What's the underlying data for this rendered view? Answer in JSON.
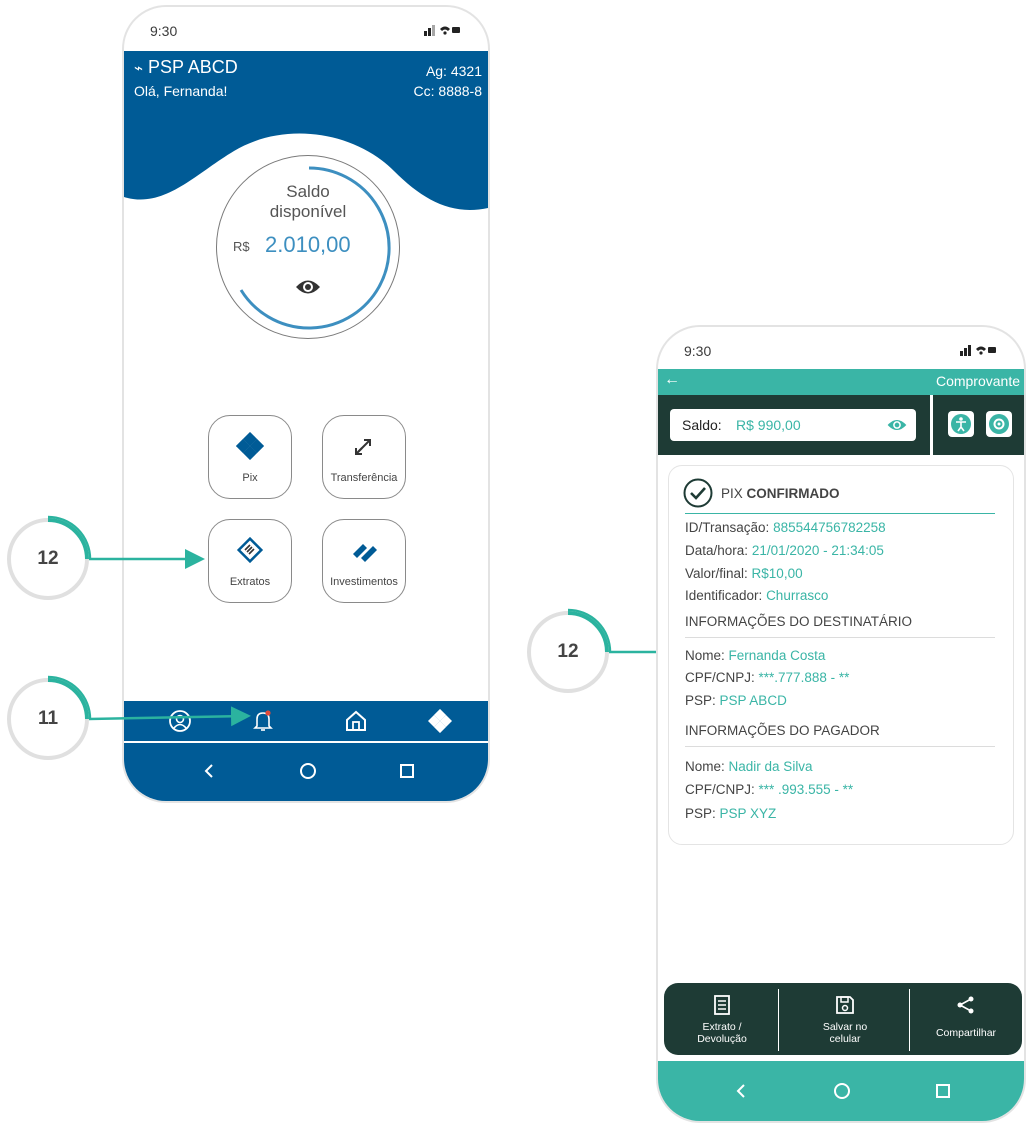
{
  "phone1": {
    "status": {
      "time": "9:30"
    },
    "header": {
      "brand": "PSP ABCD",
      "greeting": "Olá, Fernanda!",
      "agency": "Ag: 4321",
      "account": "Cc: 8888-8"
    },
    "balance": {
      "label_line1": "Saldo",
      "label_line2": "disponível",
      "currency": "R$",
      "value": "2.010,00",
      "icon": "eye-icon"
    },
    "tiles": [
      {
        "label": "Pix",
        "icon": "pix-icon"
      },
      {
        "label": "Transferência",
        "icon": "transfer-icon"
      },
      {
        "label": "Extratos",
        "icon": "statement-icon"
      },
      {
        "label": "Investimentos",
        "icon": "investments-icon"
      }
    ],
    "tabbar": [
      "profile-icon",
      "bell-icon",
      "home-icon",
      "pix-icon"
    ],
    "navbar": [
      "back-icon",
      "home-circle-icon",
      "recent-apps-icon"
    ],
    "colors": {
      "primary": "#005b96",
      "accent": "#3d8fc0"
    }
  },
  "callouts": [
    {
      "number": "12"
    },
    {
      "number": "11"
    },
    {
      "number": "12"
    }
  ],
  "phone2": {
    "status": {
      "time": "9:30"
    },
    "topbar": {
      "title": "Comprovante"
    },
    "saldo": {
      "label": "Saldo:",
      "value": "R$ 990,00"
    },
    "receipt": {
      "status_prefix": "PIX",
      "status": "CONFIRMADO",
      "id_label": "ID/Transação:",
      "id_value": "885544756782258",
      "date_label": "Data/hora:",
      "date_value": "21/01/2020 - 21:34:05",
      "amount_label": "Valor/final:",
      "amount_value": "R$10,00",
      "ident_label": "Identificador:",
      "ident_value": "Churrasco",
      "recipient_section": "INFORMAÇÕES DO DESTINATÁRIO",
      "recipient_name_label": "Nome:",
      "recipient_name": "Fernanda Costa",
      "recipient_doc_label": "CPF/CNPJ:",
      "recipient_doc": "***.777.888 - **",
      "recipient_psp_label": "PSP:",
      "recipient_psp": "PSP ABCD",
      "payer_section": "INFORMAÇÕES DO PAGADOR",
      "payer_name_label": "Nome:",
      "payer_name": "Nadir da Silva",
      "payer_doc_label": "CPF/CNPJ:",
      "payer_doc": "*** .993.555 - **",
      "payer_psp_label": "PSP:",
      "payer_psp": "PSP XYZ"
    },
    "actions": [
      {
        "label1": "Extrato /",
        "label2": "Devolução"
      },
      {
        "label1": "Salvar no",
        "label2": "celular"
      },
      {
        "label1": "Compartilhar",
        "label2": ""
      }
    ],
    "colors": {
      "primary": "#3ab5a6",
      "dark": "#1e3b35"
    }
  }
}
